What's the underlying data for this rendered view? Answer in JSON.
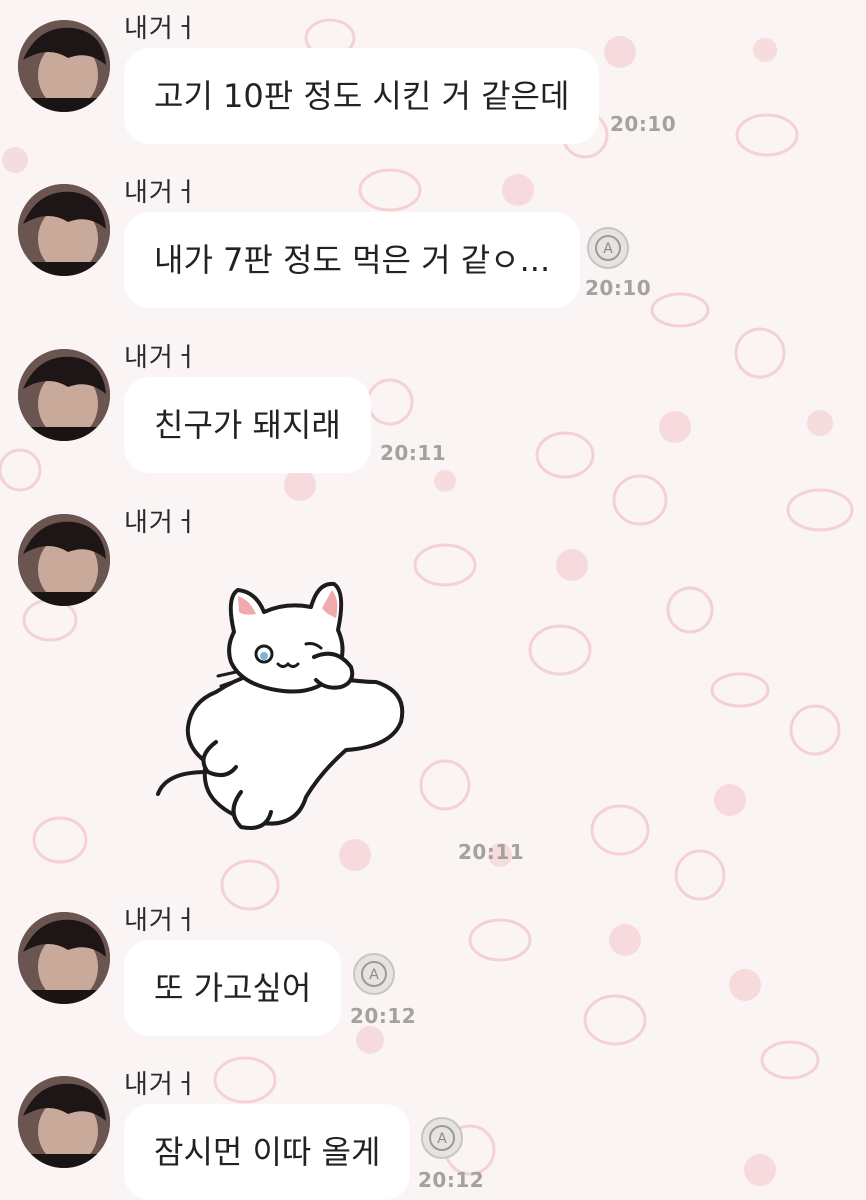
{
  "sender_name": "내거ㅓ",
  "messages": [
    {
      "text": "고기 10판 정도 시킨 거 같은데",
      "time": "20:10"
    },
    {
      "text": "내가 7판 정도 먹은 거 같ㅇ...",
      "time": "20:10"
    },
    {
      "text": "친구가 돼지래",
      "time": "20:11"
    },
    {
      "sticker": "white-cat-sticker",
      "time": "20:11"
    },
    {
      "text": "또 가고싶어",
      "time": "20:12"
    },
    {
      "text": "잠시먼 이따 올게",
      "time": "20:12"
    }
  ],
  "colors": {
    "background": "#fbf4f4",
    "bubble": "#ffffff",
    "time": "#a5a1a1",
    "pattern": "#f4cdd0"
  },
  "icons": {
    "translate": "translate-icon",
    "avatar": "avatar"
  }
}
